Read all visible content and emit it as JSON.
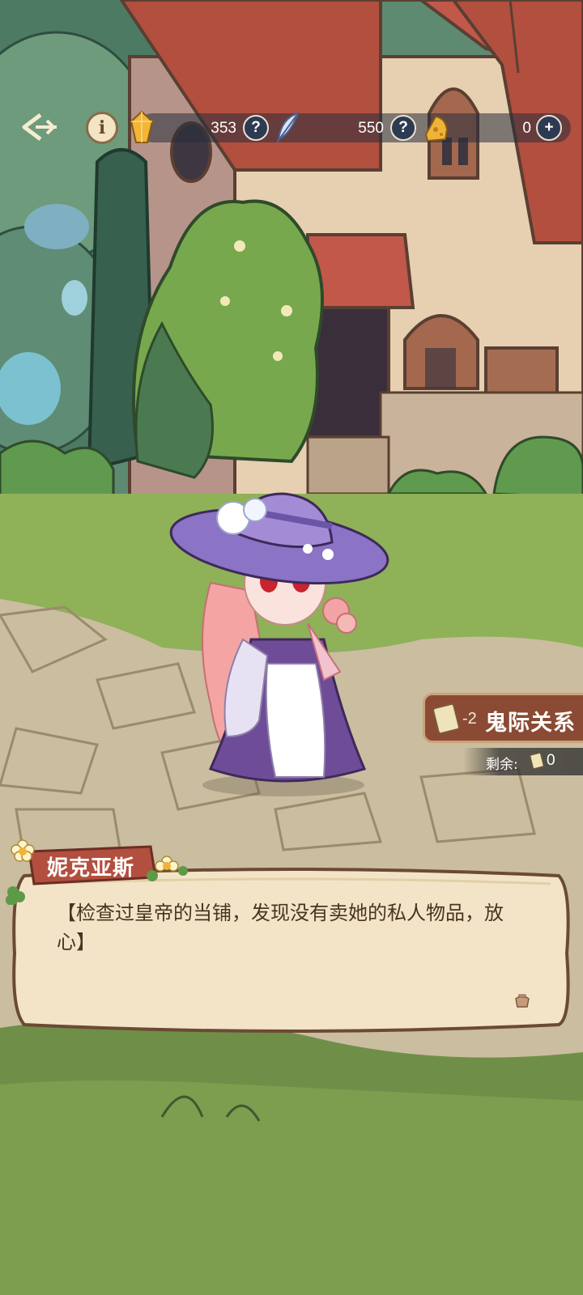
{
  "hud": {
    "back_icon": "back-arrow-icon",
    "info_label": "i",
    "resources": [
      {
        "name": "crystal",
        "icon": "amber-crystal-icon",
        "value": "353",
        "button": "?"
      },
      {
        "name": "feather",
        "icon": "feather-quill-icon",
        "value": "550",
        "button": "?"
      },
      {
        "name": "cheese",
        "icon": "cheese-icon",
        "value": "0",
        "button": "+"
      }
    ]
  },
  "relationship": {
    "cost": "-2",
    "label": "鬼际关系",
    "remaining_label": "剩余:",
    "remaining_value": "0"
  },
  "dialogue": {
    "speaker": "妮克亚斯",
    "text": "【检查过皇帝的当铺，发现没有卖她的私人物品，放心】"
  },
  "colors": {
    "roof": "#b34f3f",
    "panel": "#8a4a34",
    "dialog_bg": "#f3e4c8",
    "dress": "#6e4c98"
  }
}
